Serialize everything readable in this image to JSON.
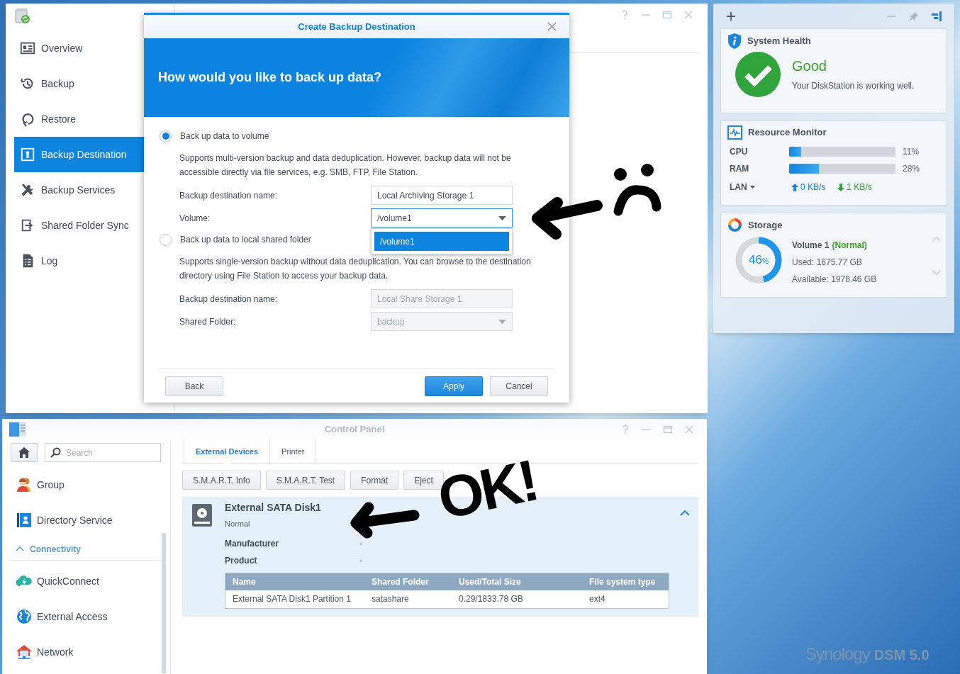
{
  "backup_window": {
    "sidebar": [
      {
        "label": "Overview",
        "selected": false
      },
      {
        "label": "Backup",
        "selected": false
      },
      {
        "label": "Restore",
        "selected": false
      },
      {
        "label": "Backup Destination",
        "selected": true
      },
      {
        "label": "Backup Services",
        "selected": false
      },
      {
        "label": "Shared Folder Sync",
        "selected": false
      },
      {
        "label": "Log",
        "selected": false
      }
    ]
  },
  "dialog": {
    "title": "Create Backup Destination",
    "heading": "How would you like to back up data?",
    "options": [
      {
        "label": "Back up data to volume",
        "selected": true,
        "description": "Supports multi-version backup and data deduplication. However, backup data will not be accessible directly via file services, e.g. SMB, FTP, File Station.",
        "fields": [
          {
            "kind": "text",
            "label": "Backup destination name:",
            "value": "Local Archiving Storage 1",
            "disabled": false
          },
          {
            "kind": "select",
            "label": "Volume:",
            "value": "/volume1",
            "disabled": false,
            "expanded": true,
            "menu": [
              {
                "label": "/volume1",
                "selected": true
              }
            ]
          }
        ]
      },
      {
        "label": "Back up data to local shared folder",
        "selected": false,
        "description": "Supports single-version backup without data deduplication. You can browse to the destination directory using File Station to access your backup data.",
        "fields": [
          {
            "kind": "text",
            "label": "Backup destination name:",
            "value": "Local Share Storage 1",
            "disabled": true
          },
          {
            "kind": "select",
            "label": "Shared Folder:",
            "value": "backup",
            "disabled": true
          }
        ]
      }
    ],
    "buttons": [
      {
        "label": "Back",
        "kind": "default"
      },
      {
        "label": "Apply",
        "kind": "primary"
      },
      {
        "label": "Cancel",
        "kind": "default"
      }
    ]
  },
  "widgets": {
    "system_health": {
      "title": "System Health",
      "status": "Good",
      "message": "Your DiskStation is working well."
    },
    "resource_monitor": {
      "title": "Resource Monitor",
      "meters": [
        {
          "label": "CPU",
          "level": 0.11,
          "reading": "11%"
        },
        {
          "label": "RAM",
          "level": 0.28,
          "reading": "28%"
        }
      ],
      "network": {
        "label": "LAN",
        "upload": "0 KB/s",
        "download": "1 KB/s"
      }
    },
    "storage": {
      "title": "Storage",
      "level": 0.46,
      "percent": "46",
      "percent_unit": "%",
      "volume": "Volume 1",
      "status": "(Normal)",
      "used": "Used: 1675.77 GB",
      "available": "Available: 1978.46 GB"
    }
  },
  "control_panel": {
    "title": "Control Panel",
    "search": {
      "placeholder": "Search"
    },
    "sidebar": [
      {
        "kind": "item",
        "label": "Group",
        "selected": false
      },
      {
        "kind": "item",
        "label": "Directory Service",
        "selected": false
      },
      {
        "kind": "section",
        "label": "Connectivity",
        "expanded": true
      },
      {
        "kind": "item",
        "label": "QuickConnect",
        "selected": false
      },
      {
        "kind": "item",
        "label": "External Access",
        "selected": false
      },
      {
        "kind": "item",
        "label": "Network",
        "selected": false
      }
    ],
    "tabs": [
      {
        "label": "External Devices",
        "selected": true
      },
      {
        "label": "Printer",
        "selected": false
      }
    ],
    "toolbar": [
      "S.M.A.R.T. Info",
      "S.M.A.R.T. Test",
      "Format",
      "Eject"
    ],
    "device": {
      "name": "External SATA Disk1",
      "status": "Normal",
      "expanded": true,
      "properties": [
        {
          "label": "Manufacturer",
          "value": "-"
        },
        {
          "label": "Product",
          "value": "-"
        }
      ],
      "table": {
        "columns": [
          "Name",
          "Shared Folder",
          "Used/Total Size",
          "File system type"
        ],
        "rows": [
          [
            "External SATA Disk1 Partition 1",
            "satashare",
            "0.29/1833.78 GB",
            "ext4"
          ]
        ]
      }
    }
  },
  "annotation": {
    "text": "OK!"
  },
  "desktop": {
    "brand": "Synology",
    "product": "DSM 5.0"
  }
}
